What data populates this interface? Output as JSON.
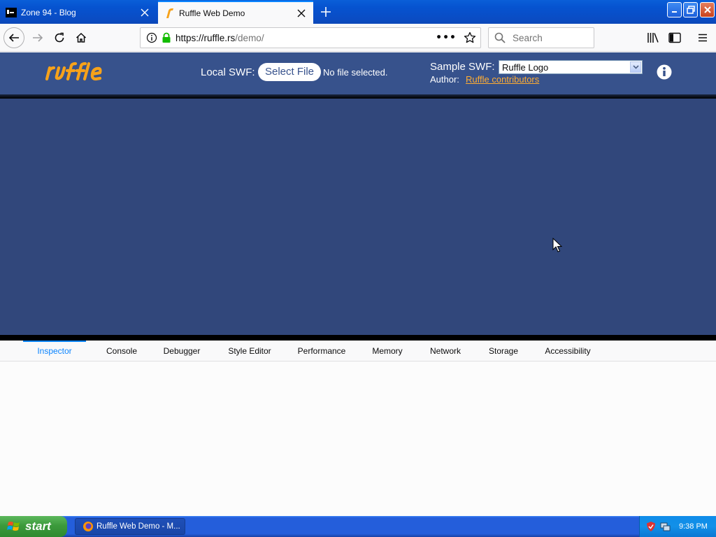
{
  "browser": {
    "tabs": [
      {
        "title": "Zone 94 - Blog",
        "active": false
      },
      {
        "title": "Ruffle Web Demo",
        "active": true
      }
    ],
    "url_host": "https://ruffle.rs",
    "url_path": "/demo/",
    "search_placeholder": "Search",
    "page_actions_icon": "•••"
  },
  "page": {
    "local_swf_label": "Local SWF:",
    "select_file_label": "Select File",
    "no_file_text": "No file selected.",
    "sample_swf_label": "Sample SWF:",
    "sample_swf_value": "Ruffle Logo",
    "author_label": "Author:",
    "author_link": "Ruffle contributors",
    "colors": {
      "header": "#37528c",
      "stage": "#31477b",
      "accent": "#ffad33"
    }
  },
  "devtools": {
    "tabs": [
      "Inspector",
      "Console",
      "Debugger",
      "Style Editor",
      "Performance",
      "Memory",
      "Network",
      "Storage",
      "Accessibility"
    ],
    "selected": "Inspector"
  },
  "taskbar": {
    "start_label": "start",
    "task_label": "Ruffle Web Demo - M...",
    "clock": "9:38 PM"
  }
}
